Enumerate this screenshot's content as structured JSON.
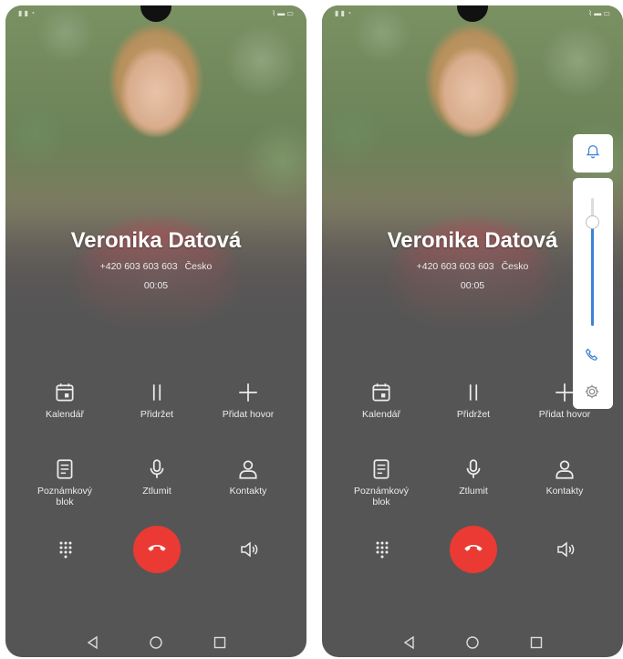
{
  "call": {
    "caller_name": "Veronika Datová",
    "phone_number": "+420 603 603 603",
    "country": "Česko",
    "duration": "00:05"
  },
  "actions": {
    "calendar": "Kalendář",
    "hold": "Přidržet",
    "add_call": "Přidat hovor",
    "notepad_line1": "Poznámkový",
    "notepad_line2": "blok",
    "mute": "Ztlumit",
    "contacts": "Kontakty"
  },
  "icons": {
    "calendar": "calendar-icon",
    "hold": "pause-icon",
    "add_call": "plus-icon",
    "notepad": "notepad-icon",
    "mute": "microphone-icon",
    "contacts": "person-icon",
    "keypad": "dialpad-icon",
    "end_call": "end-call-icon",
    "speaker": "speaker-icon",
    "nav_back": "back-triangle-icon",
    "nav_home": "home-circle-icon",
    "nav_recents": "recents-square-icon",
    "volume_ring": "bell-icon",
    "volume_call": "phone-icon",
    "volume_settings": "gear-icon"
  },
  "volume": {
    "level": 0.82
  },
  "colors": {
    "end_call": "#ea3a33",
    "accent": "#3b82d6",
    "background": "#555555"
  }
}
